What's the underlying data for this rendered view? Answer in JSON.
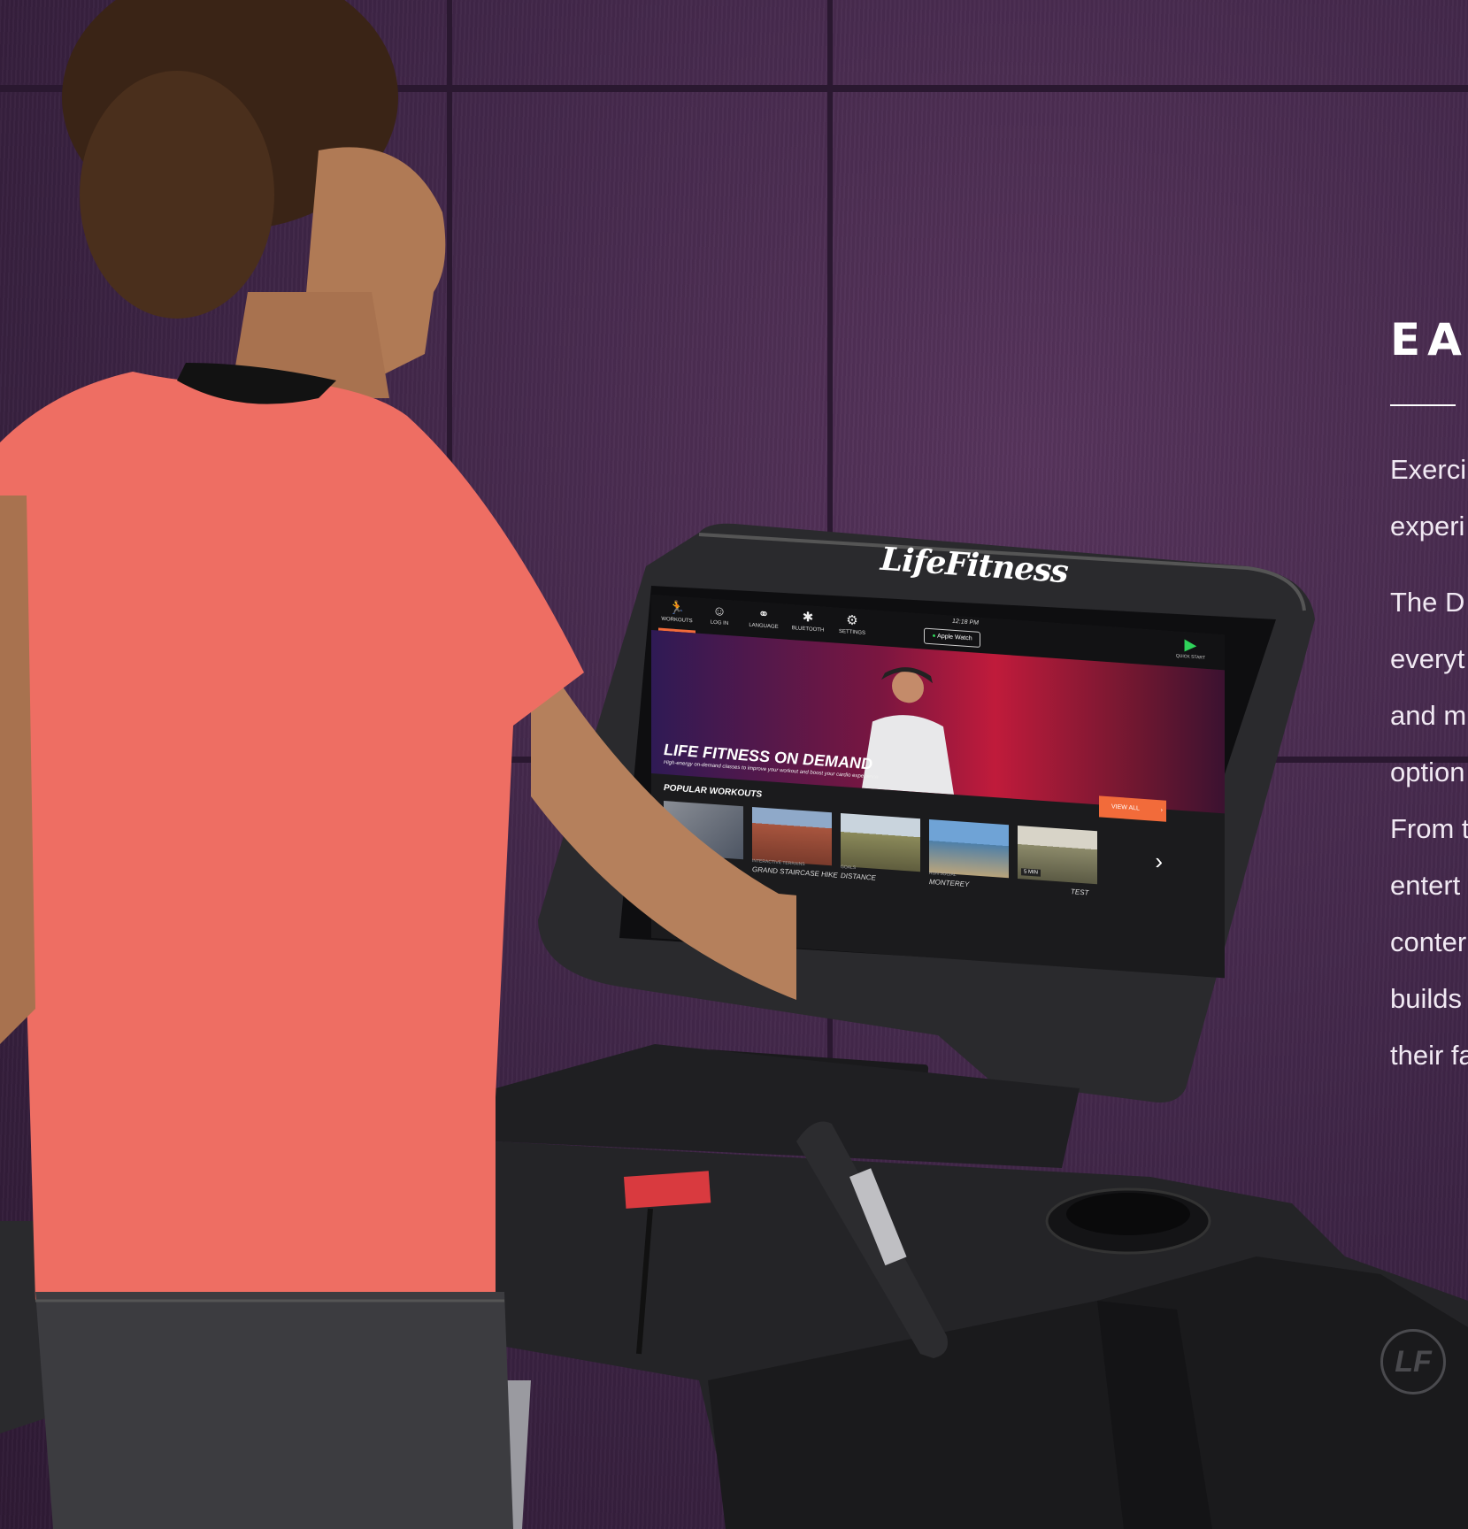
{
  "copy": {
    "heading": "EA",
    "lines": [
      "Exerci",
      "experi",
      "The D",
      "everyt",
      "and m",
      "option",
      "From t",
      "entert",
      "conter",
      "builds",
      "their fa"
    ]
  },
  "screen": {
    "time": "12:18 PM",
    "nav": [
      {
        "label": "WORKOUTS",
        "icon": "running-icon"
      },
      {
        "label": "LOG IN",
        "icon": "user-icon"
      },
      {
        "label": "LANGUAGE",
        "icon": "language-icon"
      },
      {
        "label": "BLUETOOTH",
        "icon": "bluetooth-icon"
      },
      {
        "label": "SETTINGS",
        "icon": "gear-icon"
      }
    ],
    "watch_label": "Apple Watch",
    "quick_start": "QUICK START",
    "hero_title": "LIFE FITNESS ON DEMAND",
    "hero_sub": "High-energy on-demand classes to improve your workout and boost your cardio experience",
    "view_all": "VIEW ALL",
    "popular": "POPULAR WORKOUTS",
    "workouts": [
      {
        "category": "",
        "title": ""
      },
      {
        "category": "INTERACTIVE TERRAINS",
        "title": "GRAND STAIRCASE HIKE"
      },
      {
        "category": "GOALS",
        "title": "DISTANCE"
      },
      {
        "category": "RUN SOCIAL",
        "title": "MONTEREY"
      },
      {
        "category": "",
        "title": "TEST"
      }
    ],
    "badge": "5 MIN"
  },
  "brand": "LifeFitness",
  "colors": {
    "wall": "#3d2445",
    "accent": "#f26b3a",
    "shirt": "#ee6e63",
    "text": "#ffffff"
  }
}
